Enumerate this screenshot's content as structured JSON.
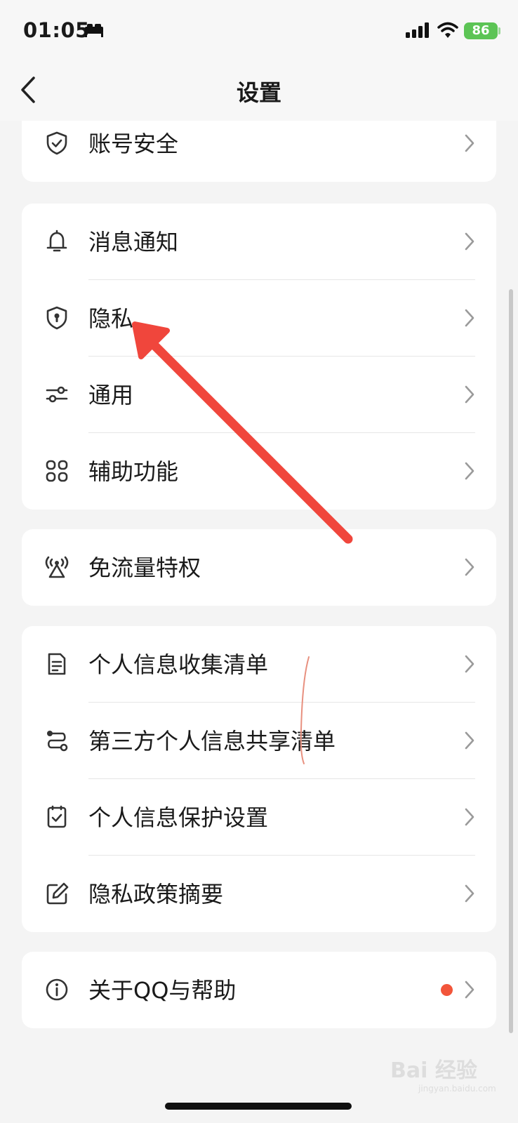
{
  "status_bar": {
    "time": "01:05",
    "battery": "86"
  },
  "header": {
    "title": "设置"
  },
  "groups": [
    [
      {
        "label": "账号安全",
        "icon": "shield-check-icon"
      }
    ],
    [
      {
        "label": "消息通知",
        "icon": "bell-icon"
      },
      {
        "label": "隐私",
        "icon": "privacy-shield-icon"
      },
      {
        "label": "通用",
        "icon": "sliders-icon"
      },
      {
        "label": "辅助功能",
        "icon": "apps-grid-icon"
      }
    ],
    [
      {
        "label": "免流量特权",
        "icon": "signal-tower-icon"
      }
    ],
    [
      {
        "label": "个人信息收集清单",
        "icon": "document-icon"
      },
      {
        "label": "第三方个人信息共享清单",
        "icon": "share-route-icon"
      },
      {
        "label": "个人信息保护设置",
        "icon": "checkbox-icon"
      },
      {
        "label": "隐私政策摘要",
        "icon": "edit-icon"
      }
    ],
    [
      {
        "label": "关于QQ与帮助",
        "icon": "info-icon",
        "badge": "red-dot"
      }
    ]
  ],
  "watermark": {
    "main": "Bai 经验",
    "sub": "jingyan.baidu.com"
  },
  "colors": {
    "background": "#f4f4f4",
    "card": "#ffffff",
    "annotation_arrow": "#f0463c",
    "badge_dot": "#f2553a",
    "battery": "#5cc455"
  }
}
